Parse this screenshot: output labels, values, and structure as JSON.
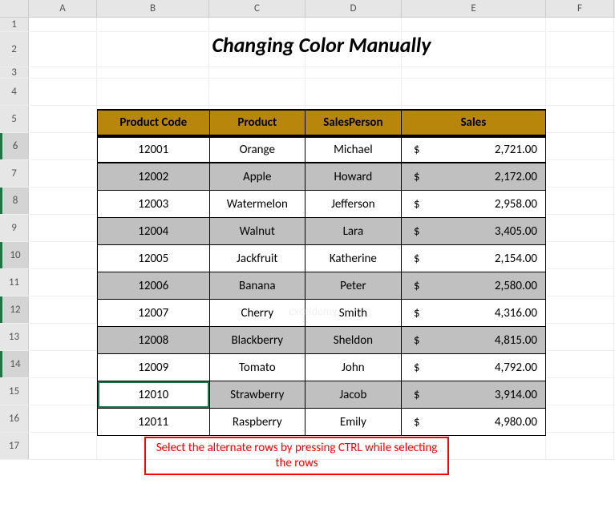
{
  "columns": [
    "A",
    "B",
    "C",
    "D",
    "E",
    "F"
  ],
  "rows": [
    "1",
    "2",
    "3",
    "4",
    "5",
    "6",
    "7",
    "8",
    "9",
    "10",
    "11",
    "12",
    "13",
    "14",
    "15",
    "16",
    "17"
  ],
  "selectedRowHeads": [
    "6",
    "8",
    "10",
    "12",
    "14"
  ],
  "title": "Changing Color Manually",
  "tableHeader": {
    "col1": "Product Code",
    "col2": "Product",
    "col3": "SalesPerson",
    "col4": "Sales"
  },
  "data": [
    {
      "code": "12001",
      "product": "Orange",
      "person": "Michael",
      "cur": "$",
      "sales": "2,721.00",
      "shaded": false
    },
    {
      "code": "12002",
      "product": "Apple",
      "person": "Howard",
      "cur": "$",
      "sales": "2,172.00",
      "shaded": true
    },
    {
      "code": "12003",
      "product": "Watermelon",
      "person": "Jefferson",
      "cur": "$",
      "sales": "2,958.00",
      "shaded": false
    },
    {
      "code": "12004",
      "product": "Walnut",
      "person": "Lara",
      "cur": "$",
      "sales": "3,405.00",
      "shaded": true
    },
    {
      "code": "12005",
      "product": "Jackfruit",
      "person": "Katherine",
      "cur": "$",
      "sales": "2,154.00",
      "shaded": false
    },
    {
      "code": "12006",
      "product": "Banana",
      "person": "Peter",
      "cur": "$",
      "sales": "2,580.00",
      "shaded": true
    },
    {
      "code": "12007",
      "product": "Cherry",
      "person": "Smith",
      "cur": "$",
      "sales": "4,316.00",
      "shaded": false
    },
    {
      "code": "12008",
      "product": "Blackberry",
      "person": "Sheldon",
      "cur": "$",
      "sales": "4,815.00",
      "shaded": true
    },
    {
      "code": "12009",
      "product": "Tomato",
      "person": "John",
      "cur": "$",
      "sales": "4,792.00",
      "shaded": false
    },
    {
      "code": "12010",
      "product": "Strawberry",
      "person": "Jacob",
      "cur": "$",
      "sales": "3,914.00",
      "shaded": true,
      "active": true
    },
    {
      "code": "12011",
      "product": "Raspberry",
      "person": "Emily",
      "cur": "$",
      "sales": "4,980.00",
      "shaded": false
    }
  ],
  "note": "Select the alternate rows by pressing CTRL while selecting the rows",
  "watermark": "exceldemy"
}
